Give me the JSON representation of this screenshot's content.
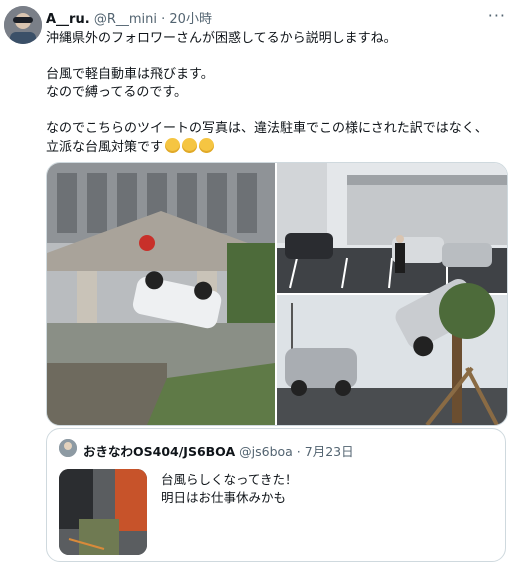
{
  "tweet": {
    "display_name": "A__ru.",
    "handle": "@R__mini",
    "separator": "·",
    "time": "20小時",
    "more_icon": "more-icon",
    "lines": [
      "沖縄県外のフォロワーさんが困惑してるから説明しますね。",
      "",
      "台風で軽自動車は飛びます。",
      "なので縛ってるのです。",
      "",
      "なのでこちらのツイートの写真は、違法駐車でこの様にされた訳ではなく、",
      "立派な台風対策です"
    ],
    "emoji": "clapping-hands-emoji"
  },
  "quoted": {
    "display_name": "おきなわOS404/JS6BOA",
    "handle": "@js6boa",
    "separator": "·",
    "date": "7月23日",
    "lines": [
      "台風らしくなってきた！",
      "明日はお仕事休みかも"
    ]
  },
  "colors": {
    "text": "#0f1419",
    "muted": "#536471",
    "border": "#cfd9de"
  }
}
